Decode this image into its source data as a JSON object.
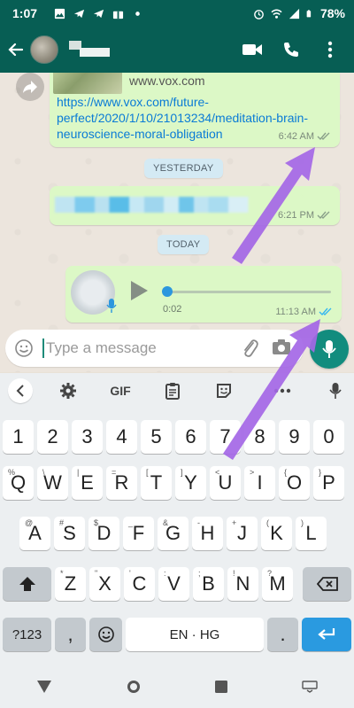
{
  "status_bar": {
    "time": "1:07",
    "battery": "78%"
  },
  "app_bar": {
    "back_icon": "arrow-left-icon",
    "video_icon": "video-call-icon",
    "call_icon": "phone-icon",
    "menu_icon": "more-vert-icon"
  },
  "messages": [
    {
      "site": "www.vox.com",
      "link": "https://www.vox.com/future-perfect/2020/1/10/21013234/meditation-brain-neuroscience-moral-obligation",
      "time": "6:42 AM"
    },
    {
      "time": "6:21 PM"
    },
    {
      "duration": "0:02",
      "time": "11:13 AM"
    }
  ],
  "date_chips": {
    "yesterday": "YESTERDAY",
    "today": "TODAY"
  },
  "input": {
    "placeholder": "Type a message"
  },
  "keyboard": {
    "toolbar": {
      "gif": "GIF"
    },
    "row_numbers": [
      "1",
      "2",
      "3",
      "4",
      "5",
      "6",
      "7",
      "8",
      "9",
      "0"
    ],
    "row1": [
      "Q",
      "W",
      "E",
      "R",
      "T",
      "Y",
      "U",
      "I",
      "O",
      "P"
    ],
    "row1_hints": [
      "%",
      "\\",
      "|",
      "=",
      "[",
      "]",
      "<",
      ">",
      "{",
      "}"
    ],
    "row2": [
      "A",
      "S",
      "D",
      "F",
      "G",
      "H",
      "J",
      "K",
      "L"
    ],
    "row2_hints": [
      "@",
      "#",
      "$",
      "_",
      "&",
      "-",
      "+",
      "(",
      ")"
    ],
    "row3": [
      "Z",
      "X",
      "C",
      "V",
      "B",
      "N",
      "M"
    ],
    "row3_hints": [
      "*",
      "\"",
      "'",
      ":",
      ";",
      "!",
      "?"
    ],
    "sym_key": "?123",
    "comma": ",",
    "space_label": "EN · HG",
    "period": "."
  },
  "colors": {
    "header": "#075e54",
    "bubble_out": "#dcf8c6",
    "link": "#0a7bd6",
    "mic_button": "#128c7e",
    "enter_key": "#2a9ae0"
  }
}
